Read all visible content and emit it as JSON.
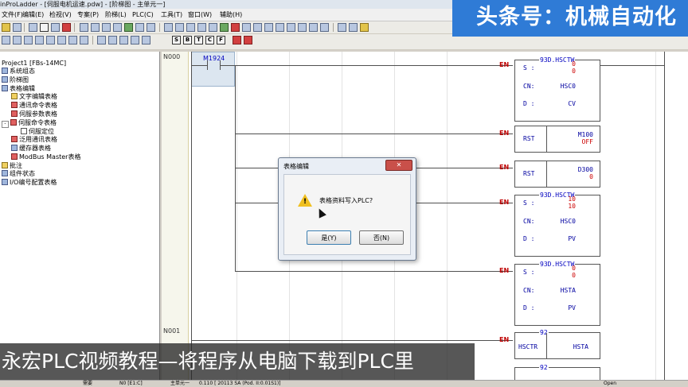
{
  "window": {
    "title": "inProLadder - [伺服电机运速.pdw] - [阶梯图 - 主单元一]"
  },
  "menu": [
    "文件(F)",
    "编辑(E)",
    "检视(V)",
    "专案(P)",
    "阶梯(L)",
    "PLC(C)",
    "工具(T)",
    "窗口(W)",
    "辅助(H)"
  ],
  "toolbar2_letters": [
    "S",
    "B",
    "T",
    "C",
    "F"
  ],
  "banner": {
    "text": "头条号：机械自动化"
  },
  "tree": {
    "items": [
      {
        "label": "Project1 [FBs-14MC]",
        "level": 0,
        "icon": "project-icon"
      },
      {
        "label": "系统组态",
        "level": 1,
        "icon": "gear-icon"
      },
      {
        "label": "阶梯图",
        "level": 1,
        "icon": "ladder-icon"
      },
      {
        "label": "表格编辑",
        "level": 1,
        "icon": "table-icon",
        "expander": "-"
      },
      {
        "label": "文字编辑表格",
        "level": 2,
        "icon": "text-table-icon"
      },
      {
        "label": "通讯命令表格",
        "level": 2,
        "icon": "comm-table-icon"
      },
      {
        "label": "伺服参数表格",
        "level": 2,
        "icon": "servo-table-icon"
      },
      {
        "label": "伺服命令表格",
        "level": 2,
        "icon": "servo-cmd-icon",
        "expander": "-"
      },
      {
        "label": "伺服定位",
        "level": 3,
        "icon": "position-icon"
      },
      {
        "label": "泛用通讯表格",
        "level": 2,
        "icon": "general-comm-icon"
      },
      {
        "label": "缓存器表格",
        "level": 2,
        "icon": "register-table-icon"
      },
      {
        "label": "ModBus Master表格",
        "level": 2,
        "icon": "modbus-icon"
      },
      {
        "label": "批注",
        "level": 1,
        "icon": "comment-icon"
      },
      {
        "label": "组件状态",
        "level": 1,
        "icon": "device-status-icon"
      },
      {
        "label": "I/O编号配置表格",
        "level": 1,
        "icon": "io-config-icon"
      }
    ]
  },
  "ladder": {
    "networks": [
      "N000",
      "N001"
    ],
    "contact": "M1924",
    "en_label": "EN",
    "blocks": [
      {
        "name": "93D.HSCTW",
        "rows": [
          {
            "reg": "S :",
            "val": "0",
            "val2": "0"
          },
          {
            "reg": "CN:",
            "val": "HSC0"
          },
          {
            "reg": "D :",
            "val": "CV"
          }
        ]
      },
      {
        "left": "RST",
        "val": "M100",
        "state": "OFF"
      },
      {
        "left": "RST",
        "val": "D300",
        "state": "0"
      },
      {
        "name": "93D.HSCTW",
        "rows": [
          {
            "reg": "S :",
            "val": "10",
            "val2": "10"
          },
          {
            "reg": "CN:",
            "val": "HSC0"
          },
          {
            "reg": "D :",
            "val": "PV"
          }
        ]
      },
      {
        "name": "93D.HSCTW",
        "rows": [
          {
            "reg": "S :",
            "val": "0",
            "val2": "0"
          },
          {
            "reg": "CN:",
            "val": "HSTA"
          },
          {
            "reg": "D :",
            "val": "PV"
          }
        ]
      },
      {
        "name": "92",
        "left": "HSCTR",
        "val": "HSTA"
      },
      {
        "name": "92"
      }
    ]
  },
  "dialog": {
    "title": "表格编辑",
    "message": "表格资料写入PLC?",
    "yes": "是(Y)",
    "no": "否(N)"
  },
  "caption": {
    "text": "永宏PLC视频教程—将程序从电脑下载到PLC里"
  },
  "status": {
    "a": "需要",
    "b": "N0 [E1:C]",
    "c": "主单元一",
    "d": "0.110 [ 20113 SA (Pod. II:0.01S1)]",
    "e": "Open"
  },
  "colors": {
    "accent": "#2f7bd6",
    "on_state": "#cc0000",
    "operand": "#0000a0"
  }
}
